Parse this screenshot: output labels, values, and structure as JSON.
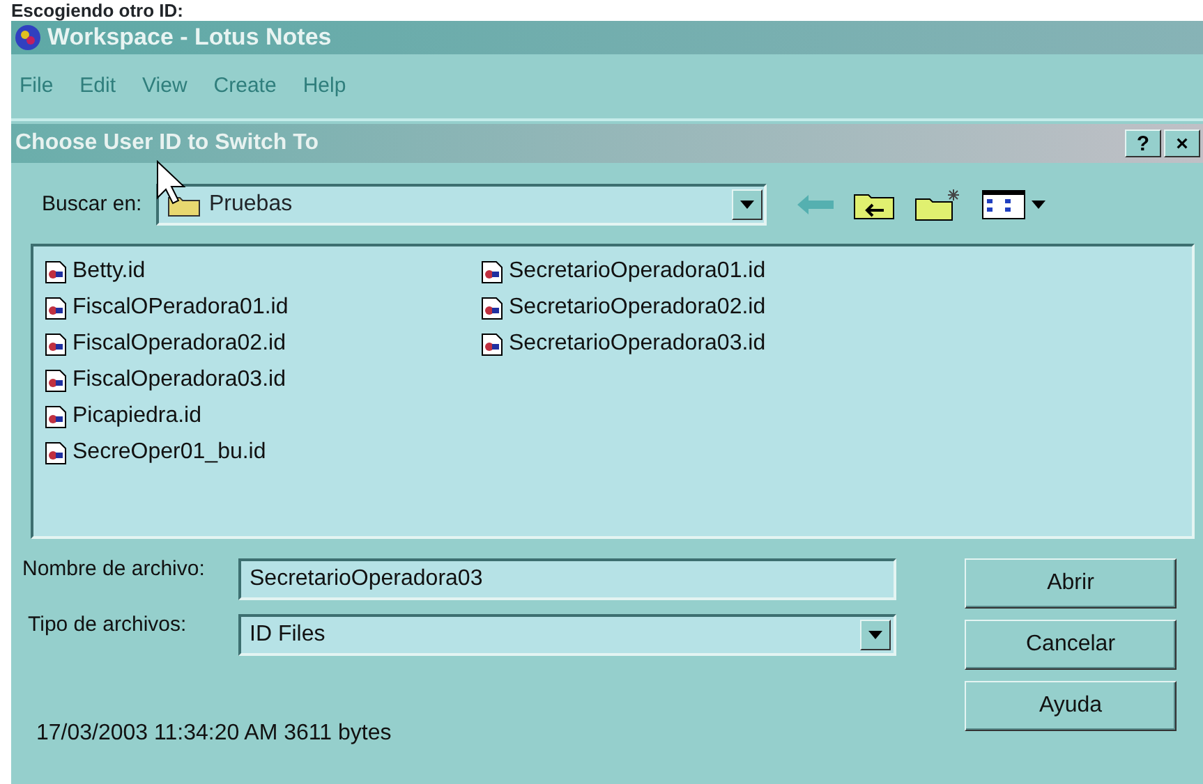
{
  "caption": "Escogiendo otro ID:",
  "window": {
    "title": "Workspace - Lotus Notes"
  },
  "menu": [
    "File",
    "Edit",
    "View",
    "Create",
    "Help"
  ],
  "dialog": {
    "title": "Choose User ID to Switch To",
    "help": "?",
    "close": "×",
    "look_in": {
      "label": "Buscar en:",
      "value": "Pruebas"
    },
    "files": [
      {
        "name": "Betty.id"
      },
      {
        "name": "FiscalOPeradora01.id"
      },
      {
        "name": "FiscalOperadora02.id"
      },
      {
        "name": "FiscalOperadora03.id"
      },
      {
        "name": "Picapiedra.id"
      },
      {
        "name": "SecreOper01_bu.id"
      },
      {
        "name": "SecretarioOperadora01.id"
      },
      {
        "name": "SecretarioOperadora02.id"
      },
      {
        "name": "SecretarioOperadora03.id"
      }
    ],
    "filename": {
      "label": "Nombre de archivo:",
      "value": "SecretarioOperadora03"
    },
    "filetype": {
      "label": "Tipo de archivos:",
      "value": "ID Files"
    },
    "buttons": [
      "Abrir",
      "Cancelar",
      "Ayuda"
    ],
    "status": "17/03/2003 11:34:20 AM 3611 bytes"
  }
}
